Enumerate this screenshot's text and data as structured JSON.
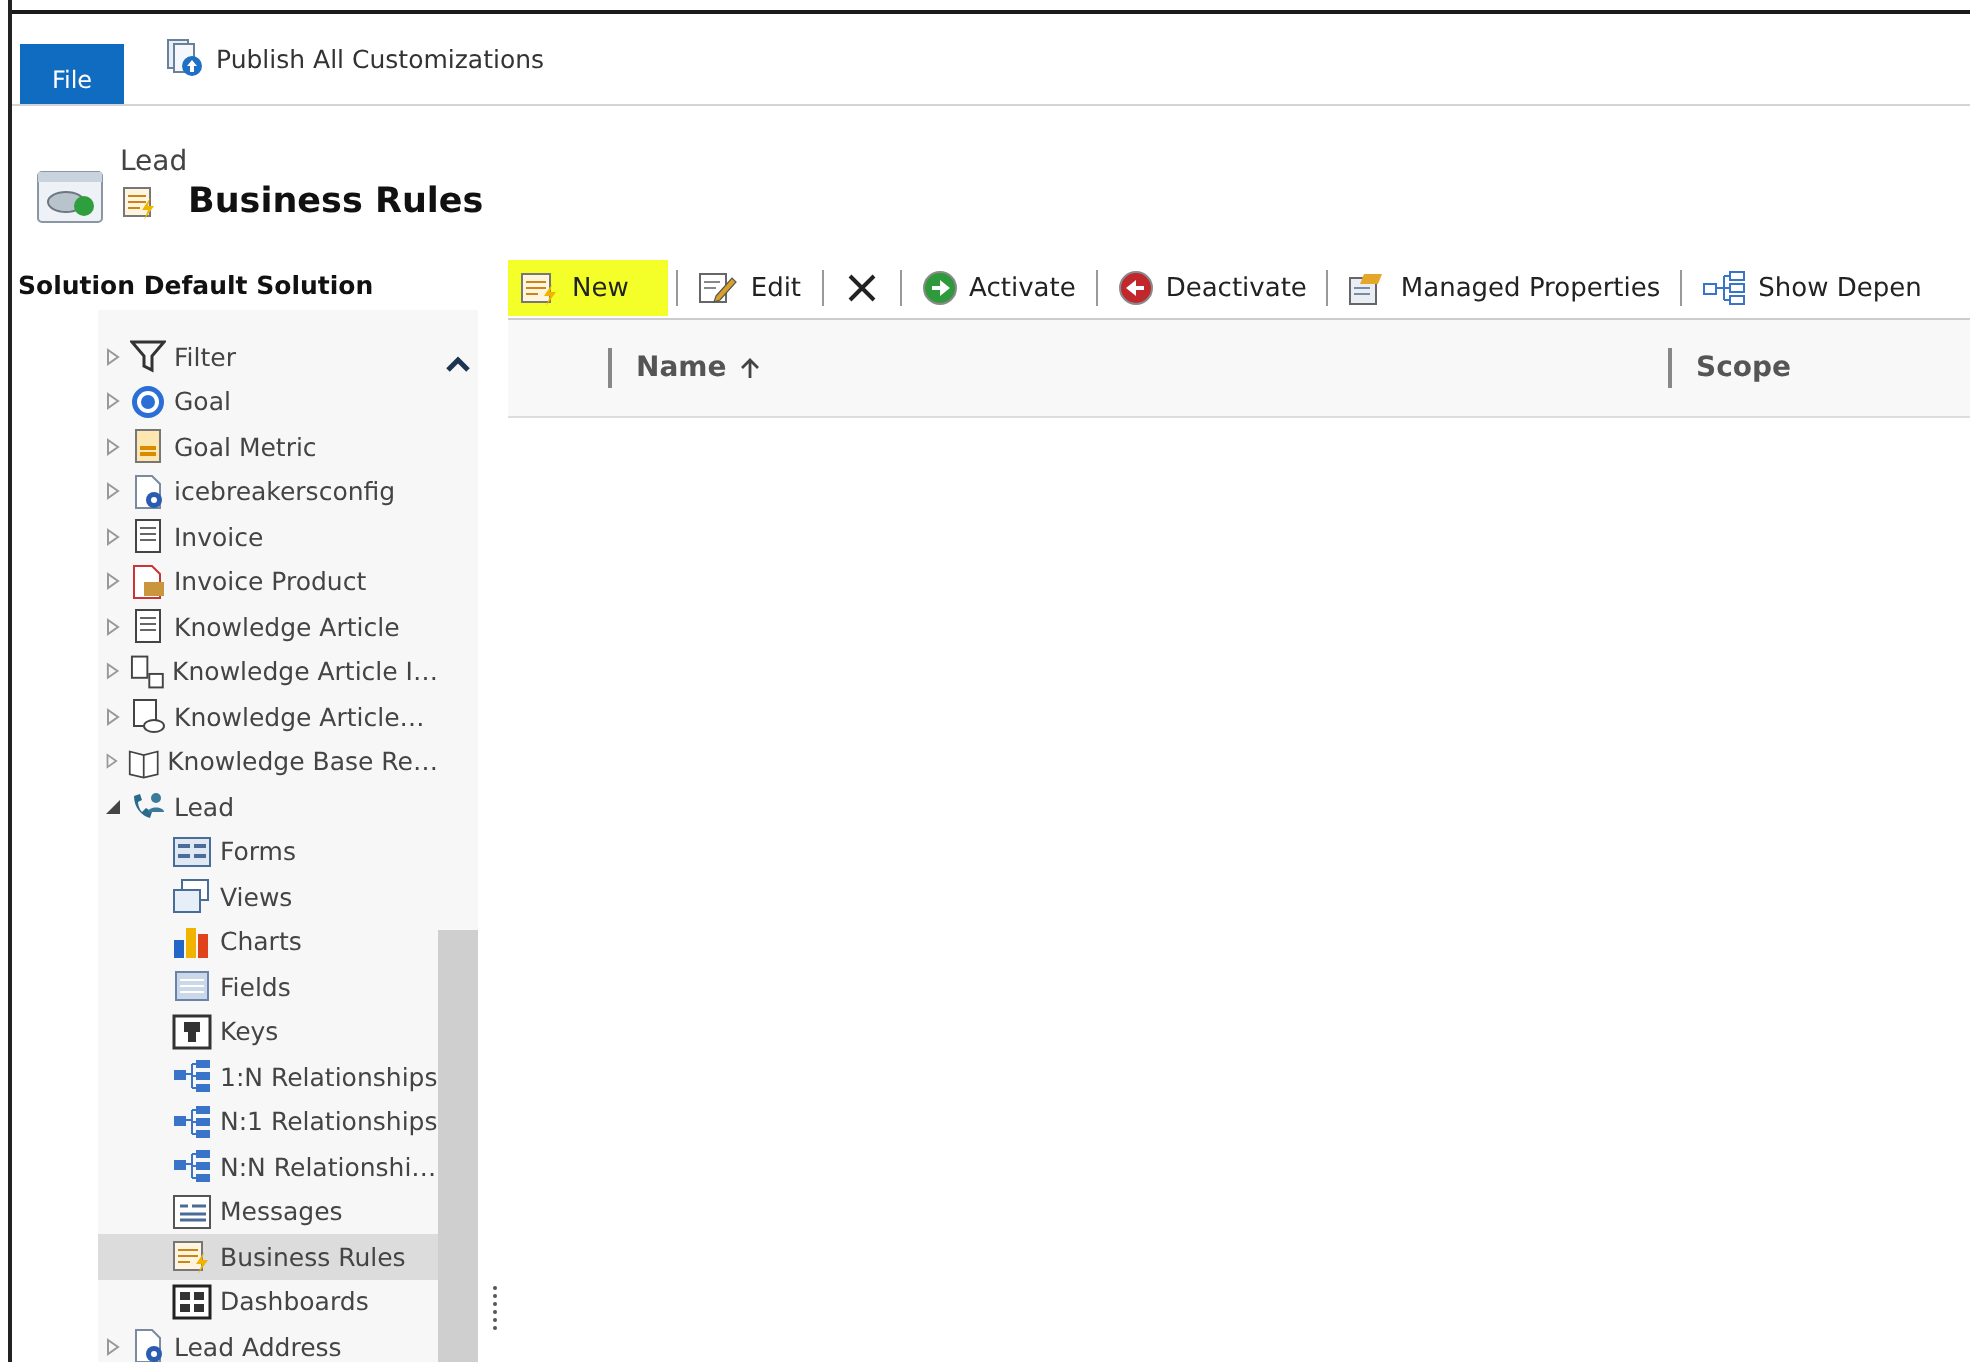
{
  "ribbon": {
    "file_tab": "File",
    "publish_button": "Publish All Customizations"
  },
  "header": {
    "entity": "Lead",
    "title": "Business Rules"
  },
  "solution": {
    "title": "Solution Default Solution"
  },
  "tree": [
    {
      "label": "Filter",
      "expanded": false
    },
    {
      "label": "Goal",
      "expanded": false
    },
    {
      "label": "Goal Metric",
      "expanded": false
    },
    {
      "label": "icebreakersconfig",
      "expanded": false
    },
    {
      "label": "Invoice",
      "expanded": false
    },
    {
      "label": "Invoice Product",
      "expanded": false
    },
    {
      "label": "Knowledge Article",
      "expanded": false
    },
    {
      "label": "Knowledge Article I…",
      "expanded": false
    },
    {
      "label": "Knowledge Article…",
      "expanded": false
    },
    {
      "label": "Knowledge Base Re…",
      "expanded": false
    },
    {
      "label": "Lead",
      "expanded": true,
      "children": [
        {
          "label": "Forms",
          "selected": false
        },
        {
          "label": "Views",
          "selected": false
        },
        {
          "label": "Charts",
          "selected": false
        },
        {
          "label": "Fields",
          "selected": false
        },
        {
          "label": "Keys",
          "selected": false
        },
        {
          "label": "1:N Relationships",
          "selected": false
        },
        {
          "label": "N:1 Relationships",
          "selected": false
        },
        {
          "label": "N:N Relationshi…",
          "selected": false
        },
        {
          "label": "Messages",
          "selected": false
        },
        {
          "label": "Business Rules",
          "selected": true
        },
        {
          "label": "Dashboards",
          "selected": false
        }
      ]
    },
    {
      "label": "Lead Address",
      "expanded": false
    }
  ],
  "toolbar": [
    {
      "kind": "new",
      "label": "New",
      "highlighted": true
    },
    {
      "kind": "edit",
      "label": "Edit",
      "highlighted": false
    },
    {
      "kind": "delete",
      "highlighted": false
    },
    {
      "kind": "activate",
      "label": "Activate",
      "highlighted": false
    },
    {
      "kind": "deactivate",
      "label": "Deactivate",
      "highlighted": false
    },
    {
      "kind": "properties",
      "label": "Managed Properties",
      "highlighted": false
    },
    {
      "kind": "dependencies",
      "label": "Show Depen",
      "highlighted": false
    }
  ],
  "table": {
    "columns": [
      {
        "label": "Name",
        "sorted": true
      },
      {
        "label": "Scope",
        "sorted": false
      }
    ]
  }
}
